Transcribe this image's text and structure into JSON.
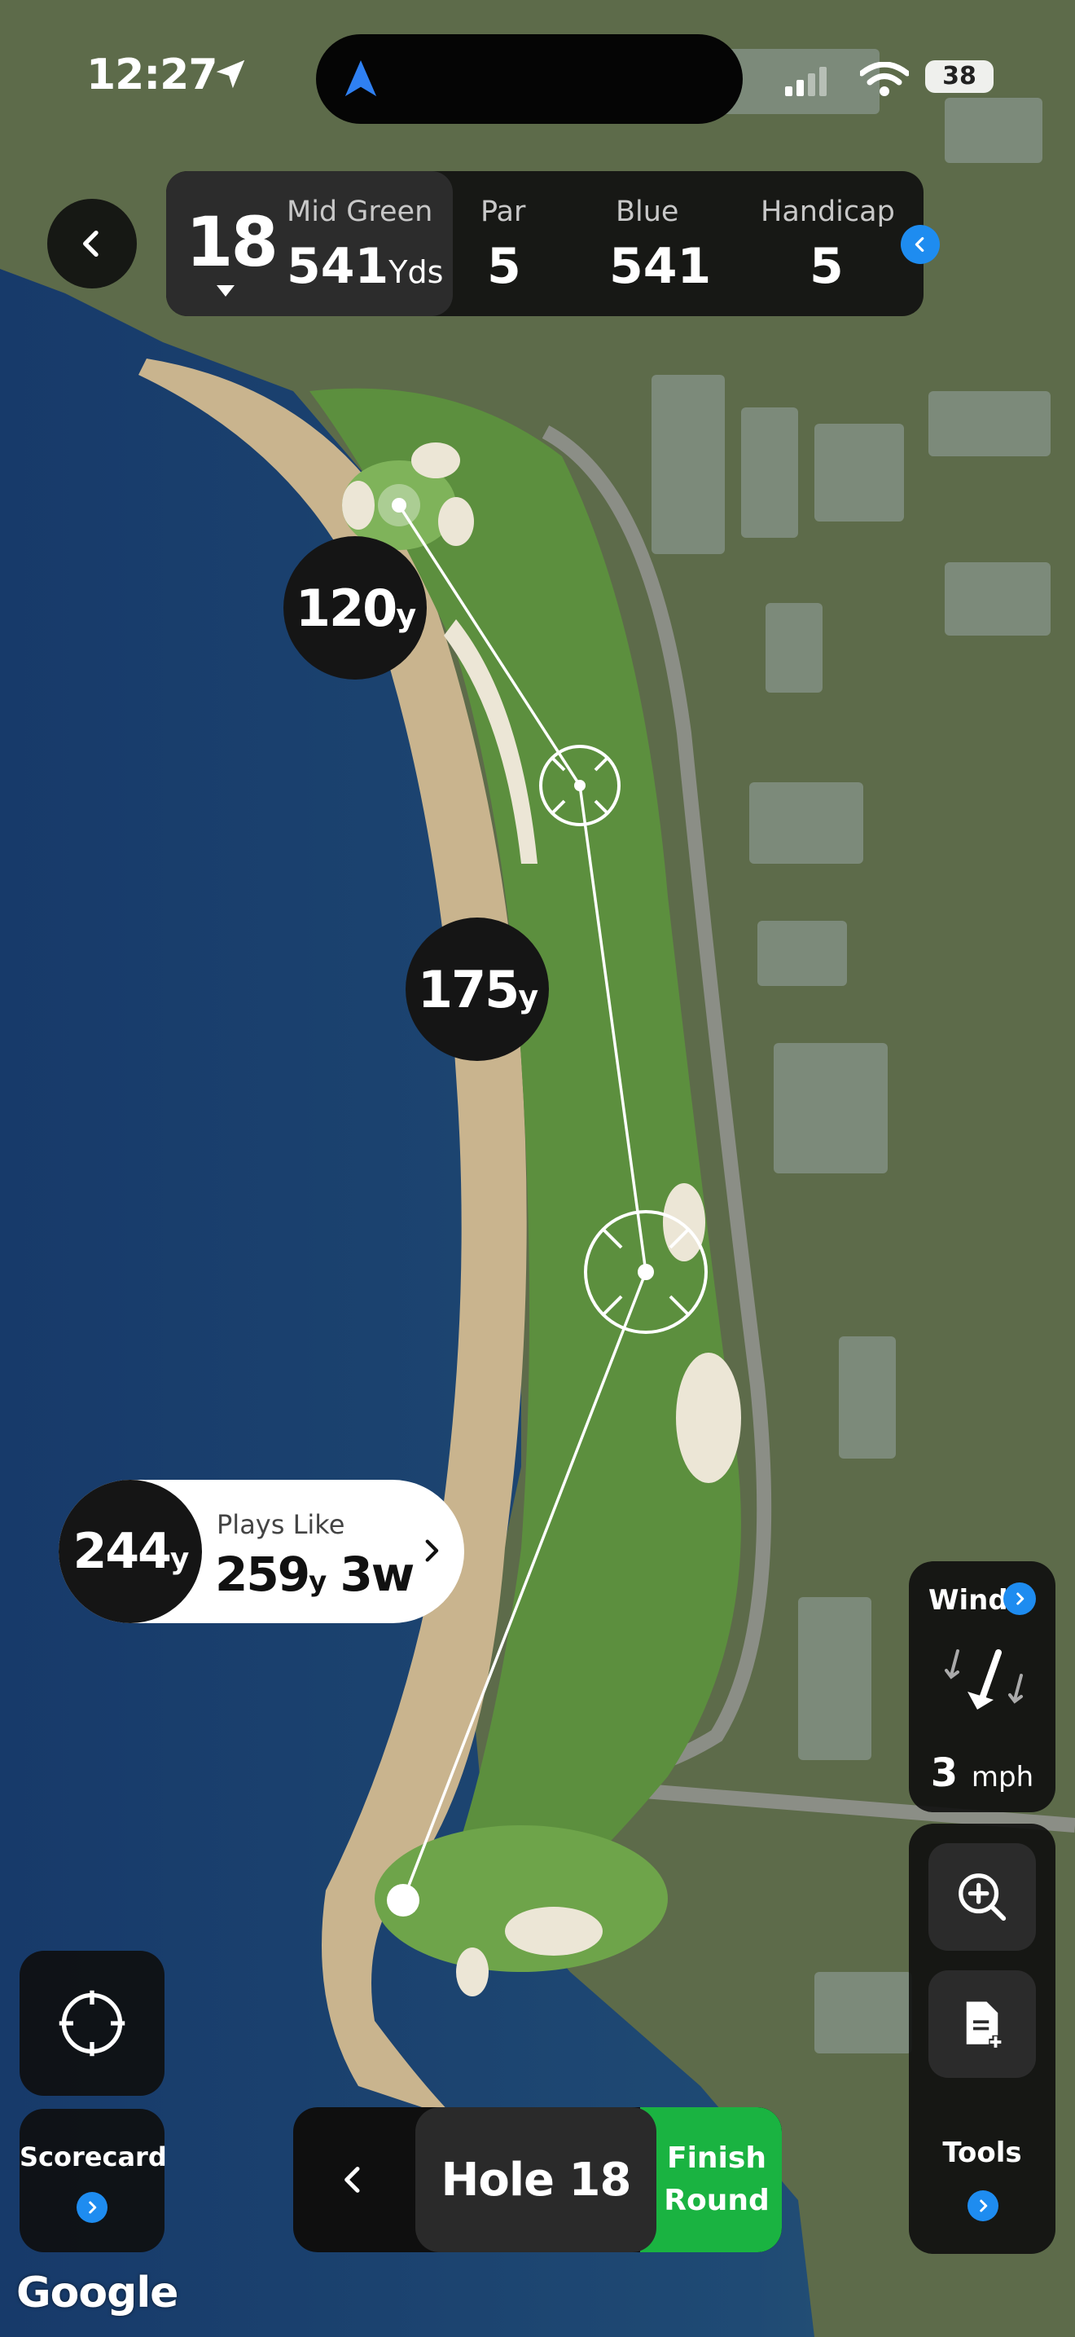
{
  "status_bar": {
    "time": "12:27",
    "battery": "38"
  },
  "header": {
    "hole_number": "18",
    "green_label": "Mid Green",
    "green_yards": "541",
    "yards_unit": "Yds",
    "par_label": "Par",
    "par_value": "5",
    "tee_label": "Blue",
    "tee_yards": "541",
    "handicap_label": "Handicap",
    "handicap_value": "5"
  },
  "map": {
    "distances": {
      "to_green": "120",
      "middle": "175",
      "unit": "y"
    },
    "attribution": "Google"
  },
  "plays_like": {
    "distance": "244",
    "unit": "y",
    "label": "Plays Like",
    "adjusted": "259",
    "club": "3w"
  },
  "wind": {
    "label": "Wind",
    "speed": "3",
    "unit": "mph"
  },
  "tools": {
    "label": "Tools"
  },
  "scorecard": {
    "label": "Scorecard"
  },
  "hole_nav": {
    "current": "Hole 18",
    "finish": "Finish\nRound"
  },
  "colors": {
    "accent_blue": "#1e8cf0",
    "finish_green": "#1ab341",
    "panel_dark": "#0f0f0f"
  }
}
